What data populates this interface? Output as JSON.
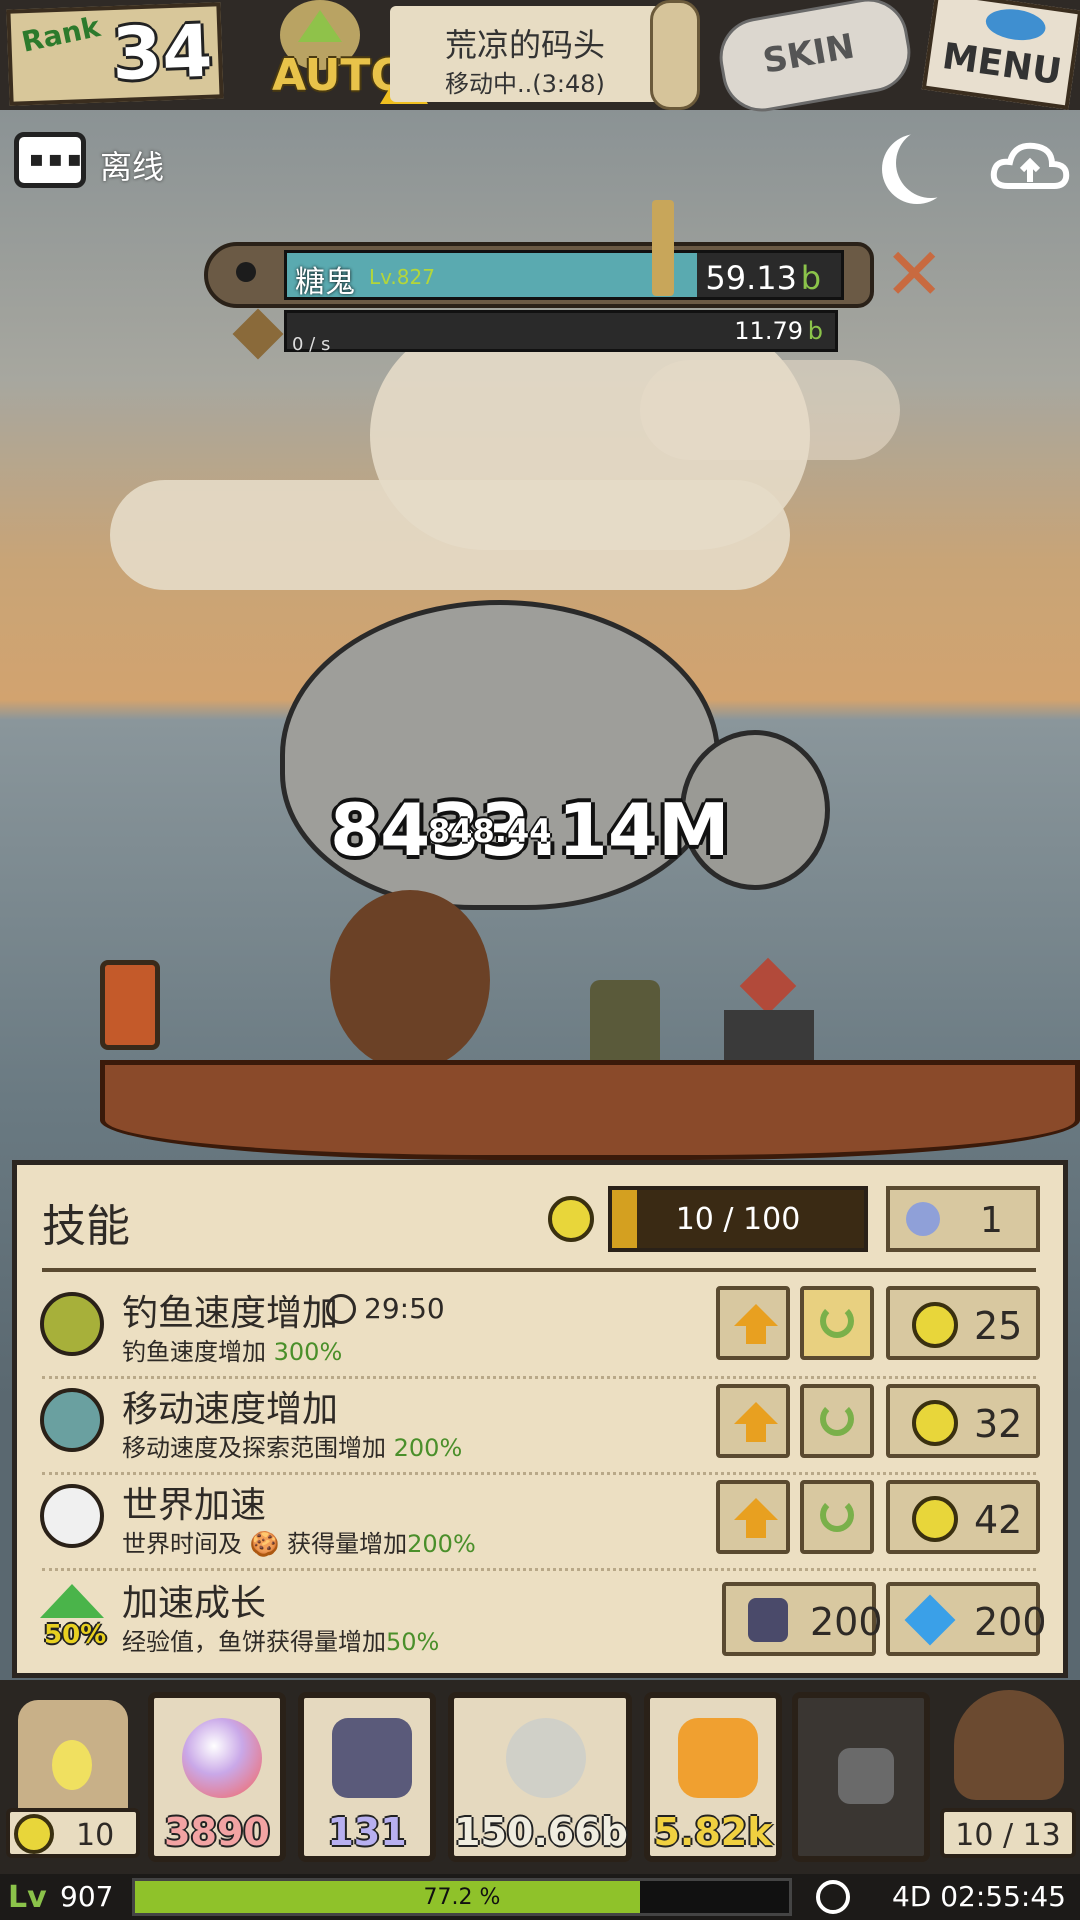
{
  "top": {
    "rank_label": "Rank",
    "rank_value": "34",
    "auto_label": "AUTO",
    "location_name": "荒凉的码头",
    "location_status": "移动中..(3:48)",
    "skin_label": "SKIN",
    "menu_label": "MENU"
  },
  "status": {
    "chat_label": "离线"
  },
  "boss": {
    "name": "糖鬼",
    "level": "Lv.827",
    "hp_value": "59.13",
    "hp_unit": "b",
    "hp_fraction": 0.74,
    "dps_value": "11.79",
    "dps_unit": "b",
    "dps_rate": "0 / s"
  },
  "damage": {
    "big": "8433.14M",
    "small": "848.44"
  },
  "skills": {
    "title": "技能",
    "points": "10 / 100",
    "points_fraction": 0.1,
    "potion_count": "1",
    "rows": [
      {
        "name": "钓鱼速度增加",
        "timer": "29:50",
        "desc": "钓鱼速度增加 ",
        "desc_pct": "300%",
        "cost": "25"
      },
      {
        "name": "移动速度增加",
        "timer": "",
        "desc": "移动速度及探索范围增加 ",
        "desc_pct": "200%",
        "cost": "32"
      },
      {
        "name": "世界加速",
        "timer": "",
        "desc": "世界时间及 🍪 获得量增加",
        "desc_pct": "200%",
        "cost": "42"
      },
      {
        "name": "加速成长",
        "timer": "",
        "desc": "经验值，鱼饼获得量增加",
        "desc_pct": "50%",
        "cost_shield": "200",
        "cost_gem": "200"
      }
    ],
    "boost_badge": "50%"
  },
  "inventory": {
    "lamp_count": "10",
    "slots": [
      "3890",
      "131",
      "150.66b",
      "5.82k"
    ],
    "bag_count": "10 / 13"
  },
  "footer": {
    "level": "907",
    "xp_percent": "77.2 %",
    "xp_fraction": 0.772,
    "time": "4D 02:55:45"
  },
  "colors": {
    "panel_bg": "#ecdfc2",
    "slot_orb": "#c9a8e8",
    "slot_shield": "#5a5a7a",
    "slot_shell": "#d0d0c8",
    "slot_gold": "#f0a030",
    "xp_fill": "#8fc22a",
    "hp_fill": "#5aaab0"
  },
  "icons": {
    "rank": "rank-badge-icon",
    "auto": "auto-arrow-icon",
    "moon": "moon-icon",
    "cloud": "cloud-upload-icon",
    "close": "close-x-icon"
  }
}
